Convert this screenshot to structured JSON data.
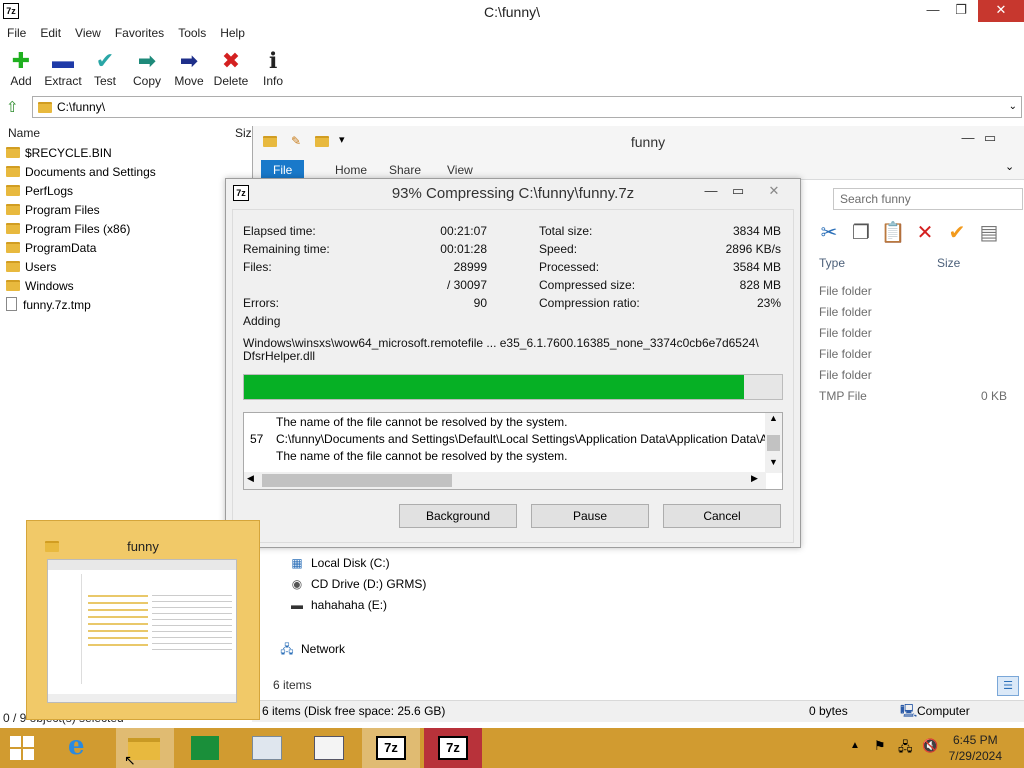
{
  "zip_window": {
    "title": "C:\\funny\\",
    "menu": [
      "File",
      "Edit",
      "View",
      "Favorites",
      "Tools",
      "Help"
    ],
    "toolbar": [
      {
        "label": "Add",
        "icon": "plus-icon",
        "glyph": "✚",
        "color": "#1fb01f"
      },
      {
        "label": "Extract",
        "icon": "minus-icon",
        "glyph": "▬",
        "color": "#1e3aa8"
      },
      {
        "label": "Test",
        "icon": "test-check-icon",
        "glyph": "✔",
        "color": "#2aa6a6"
      },
      {
        "label": "Copy",
        "icon": "copy-arrow-icon",
        "glyph": "➡",
        "color": "#1e8a7a"
      },
      {
        "label": "Move",
        "icon": "move-arrow-icon",
        "glyph": "➡",
        "color": "#1e2f8a"
      },
      {
        "label": "Delete",
        "icon": "delete-x-icon",
        "glyph": "✖",
        "color": "#d42020"
      },
      {
        "label": "Info",
        "icon": "info-icon",
        "glyph": "ℹ",
        "color": "#222222"
      }
    ],
    "address": "C:\\funny\\",
    "columns": {
      "name": "Name",
      "size": "Size"
    },
    "items": [
      {
        "name": "$RECYCLE.BIN",
        "kind": "folder"
      },
      {
        "name": "Documents and Settings",
        "kind": "folder"
      },
      {
        "name": "PerfLogs",
        "kind": "folder"
      },
      {
        "name": "Program Files",
        "kind": "folder"
      },
      {
        "name": "Program Files (x86)",
        "kind": "folder"
      },
      {
        "name": "ProgramData",
        "kind": "folder"
      },
      {
        "name": "Users",
        "kind": "folder"
      },
      {
        "name": "Windows",
        "kind": "folder"
      },
      {
        "name": "funny.7z.tmp",
        "kind": "file"
      }
    ],
    "status": "0 / 9 object(s) selected"
  },
  "explorer": {
    "title": "funny",
    "tabs": [
      "File",
      "Home",
      "Share",
      "View"
    ],
    "search_placeholder": "Search funny",
    "columns": {
      "type": "Type",
      "size": "Size"
    },
    "rows": [
      {
        "type": "File folder",
        "size": ""
      },
      {
        "type": "File folder",
        "size": ""
      },
      {
        "type": "File folder",
        "size": ""
      },
      {
        "type": "File folder",
        "size": ""
      },
      {
        "type": "File folder",
        "size": ""
      },
      {
        "type": "TMP File",
        "size": "0 KB"
      }
    ],
    "nav": [
      {
        "label": "Local Disk (C:)",
        "icon": "local-disk-icon"
      },
      {
        "label": "CD Drive (D:) GRMS)",
        "icon": "cd-drive-icon"
      },
      {
        "label": "hahahaha (E:)",
        "icon": "removable-drive-icon"
      },
      {
        "label": "Network",
        "icon": "network-icon"
      }
    ],
    "item_count": "6 items",
    "status_left": "6 items (Disk free space: 25.6 GB)",
    "status_mid": "0 bytes",
    "status_right": "Computer"
  },
  "dialog": {
    "title": "93% Compressing C:\\funny\\funny.7z",
    "progress": 0.93,
    "left_stats": [
      {
        "label": "Elapsed time:",
        "value": "00:21:07"
      },
      {
        "label": "Remaining time:",
        "value": "00:01:28"
      },
      {
        "label": "Files:",
        "value": "28999"
      },
      {
        "label": "",
        "value": "/ 30097"
      },
      {
        "label": "Errors:",
        "value": "90"
      }
    ],
    "right_stats": [
      {
        "label": "Total size:",
        "value": "3834 MB"
      },
      {
        "label": "Speed:",
        "value": "2896 KB/s"
      },
      {
        "label": "Processed:",
        "value": "3584 MB"
      },
      {
        "label": "Compressed size:",
        "value": "828 MB"
      },
      {
        "label": "Compression ratio:",
        "value": "23%"
      }
    ],
    "adding_label": "Adding",
    "current_file_1": "Windows\\winsxs\\wow64_microsoft.remotefile ... e35_6.1.7600.16385_none_3374c0cb6e7d6524\\",
    "current_file_2": "DfsrHelper.dll",
    "log": [
      {
        "num": "",
        "text": "The name of the file cannot be resolved by the system."
      },
      {
        "num": "57",
        "text": "C:\\funny\\Documents and Settings\\Default\\Local Settings\\Application Data\\Application Data\\Applicatio"
      },
      {
        "num": "",
        "text": "The name of the file cannot be resolved by the system."
      }
    ],
    "buttons": {
      "background": "Background",
      "pause": "Pause",
      "cancel": "Cancel"
    }
  },
  "thumbnail": {
    "title": "funny"
  },
  "taskbar": {
    "time": "6:45 PM",
    "date": "7/29/2024"
  }
}
